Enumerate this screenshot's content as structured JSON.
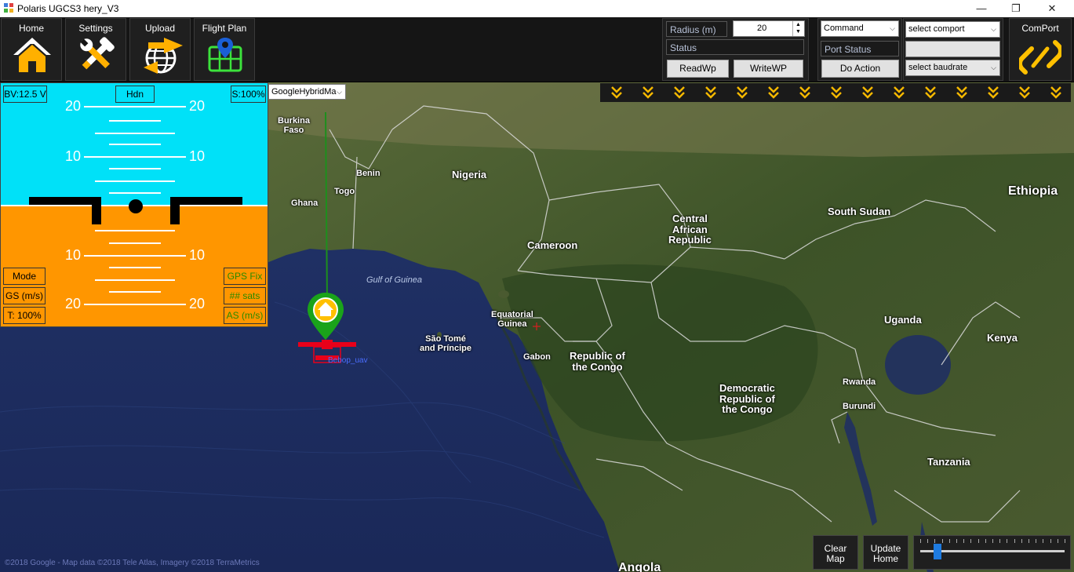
{
  "window": {
    "title": "Polaris UGCS3 hery_V3",
    "controls": [
      "minimize",
      "restore",
      "close"
    ]
  },
  "nav": [
    {
      "label": "Home",
      "icon": "house-icon"
    },
    {
      "label": "Settings",
      "icon": "tools-icon"
    },
    {
      "label": "Upload",
      "icon": "globe-sync-icon"
    },
    {
      "label": "Flight Plan",
      "icon": "map-pin-icon"
    }
  ],
  "mission": {
    "radius_label": "Radius (m)",
    "radius_value": "20",
    "status_label": "Status",
    "read_button": "ReadWp",
    "write_button": "WriteWP"
  },
  "command": {
    "select_value": "Command",
    "port_status_label": "Port Status",
    "action_button": "Do Action"
  },
  "comport": {
    "port_select": "select comport",
    "baud_select": "select baudrate",
    "button_label": "ComPort"
  },
  "hud": {
    "battery": "BV:12.5 V",
    "heading": "Hdn",
    "signal": "S:100%",
    "mode": "Mode",
    "ground_speed": "GS (m/s)",
    "throttle": "T: 100%",
    "gps_fix": "GPS Fix",
    "sats": "## sats",
    "air_speed": "AS (m/s)",
    "pitch_ticks": [
      "20",
      "10",
      "10",
      "20"
    ],
    "colors": {
      "sky": "#00e1f8",
      "ground": "#ff9600",
      "readout_green": "#2a8a00"
    }
  },
  "map": {
    "provider_select": "GoogleHybridMa",
    "places": [
      {
        "name": "Burkina\nFaso"
      },
      {
        "name": "Benin"
      },
      {
        "name": "Nigeria"
      },
      {
        "name": "Togo"
      },
      {
        "name": "Ghana"
      },
      {
        "name": "Cameroon"
      },
      {
        "name": "Central\nAfrican\nRepublic"
      },
      {
        "name": "South Sudan"
      },
      {
        "name": "Ethiopia"
      },
      {
        "name": "Equatorial\nGuinea"
      },
      {
        "name": "São Tomé\nand Príncipe"
      },
      {
        "name": "Gabon"
      },
      {
        "name": "Republic of\nthe Congo"
      },
      {
        "name": "Uganda"
      },
      {
        "name": "Kenya"
      },
      {
        "name": "Rwanda"
      },
      {
        "name": "Burundi"
      },
      {
        "name": "Democratic\nRepublic of\nthe Congo"
      },
      {
        "name": "Tanzania"
      },
      {
        "name": "Angola"
      }
    ],
    "sea_label": "Gulf of Guinea",
    "copyright": "©2018 Google - Map data ©2018 Tele Atlas, Imagery ©2018 TerraMetrics",
    "vehicle_label": "Bebop_uav",
    "colors": {
      "home_marker": "#1aa31a",
      "home_inner": "#ffc000",
      "uav": "#e8001a",
      "track": "#1d8f1d"
    }
  },
  "controls": {
    "clear_map": "Clear\nMap",
    "update_home": "Update\nHome",
    "zoom_level": 0.12
  },
  "arrow_strip": {
    "count": 15,
    "color": "#f5b800"
  }
}
